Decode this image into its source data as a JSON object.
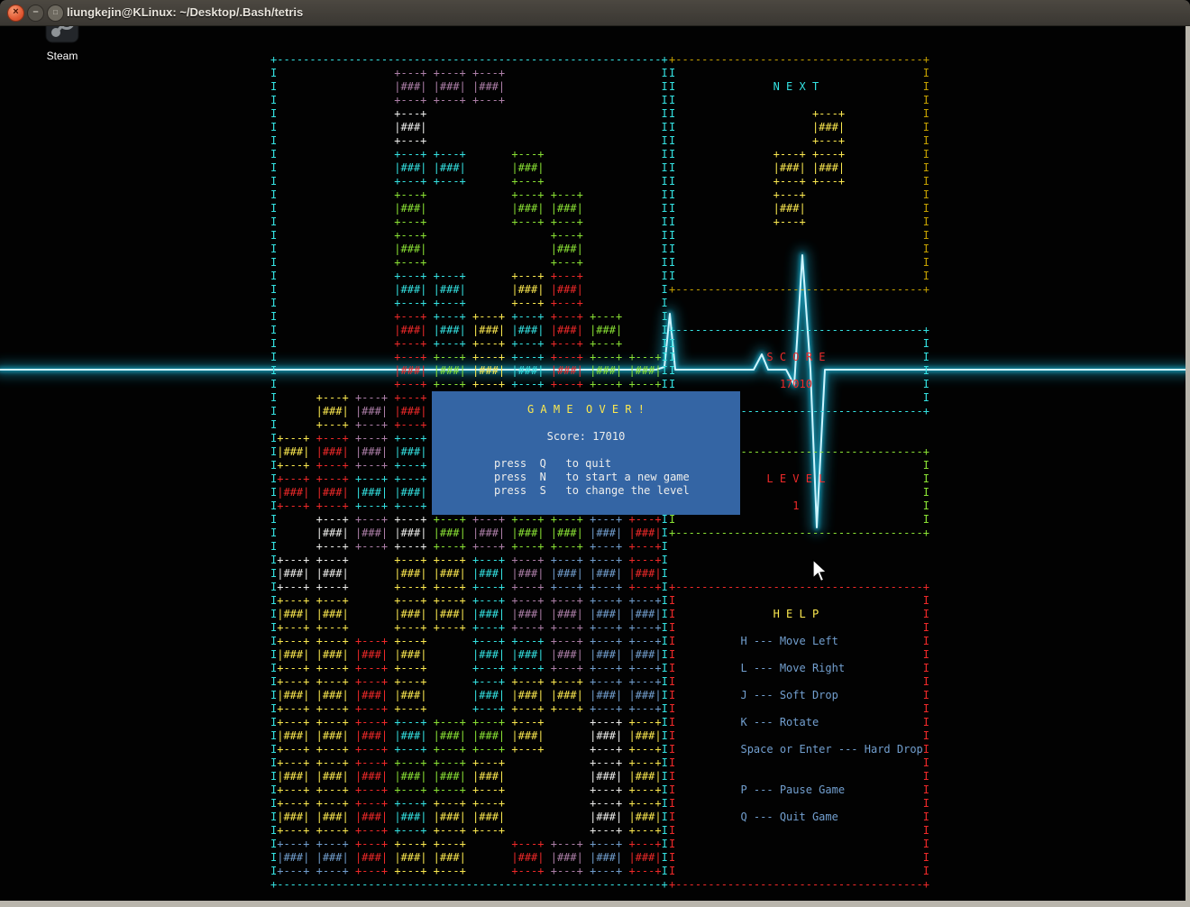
{
  "window": {
    "title": "liungkejin@KLinux: ~/Desktop/.Bash/tetris"
  },
  "desktop": {
    "steam_label": "Steam"
  },
  "palette": {
    "cyan": "#34e2e2",
    "green": "#8ae234",
    "yellow": "#fce94f",
    "red": "#ef2929",
    "magenta": "#ad7fa8",
    "blue": "#729fcf",
    "white": "#eeeeec",
    "field_border": "#34e2e2",
    "next_border": "#c4a000",
    "score_border": "#34e2e2",
    "level_border": "#8ae234",
    "help_border": "#ef2929",
    "help_text": "#729fcf",
    "dialog_bg": "#3465a4",
    "ekg": "#1ec8ee"
  },
  "playfield": {
    "cols": 10,
    "rows": 20,
    "grid": [
      "...MMM....",
      "...W......",
      "...CC.G...",
      "...G..GG..",
      "...G...G..",
      "...CC.YR..",
      "...RCYCRG.",
      "...RGYCRGG",
      ".YMR......",
      "YRMC......",
      "RRCC......",
      ".WMWGMGGBR",
      "WW.YYCMBBR",
      "YY.YYCMMBB",
      "YYRY.CCMBB",
      "YYRY.CYYBB",
      "YYRCGGY.WY",
      "YYRGGY..WY",
      "YYRCYY..WY",
      "BBRYY.RMBR"
    ]
  },
  "next_box": {
    "title": "N E X T",
    "piece": [
      ".Y",
      "YY",
      "Y."
    ]
  },
  "score_box": {
    "title": "S C O R E",
    "value": "17010"
  },
  "level_box": {
    "title": "L E V E L",
    "value": "1"
  },
  "help_box": {
    "title": "H E L P",
    "items": [
      "H --- Move Left",
      "L --- Move Right",
      "J --- Soft Drop",
      "K --- Rotate",
      "Space or Enter --- Hard Drop",
      "P --- Pause Game",
      "Q --- Quit Game"
    ]
  },
  "dialog": {
    "title": "G A M E  O V E R !",
    "score_label": "Score: 17010",
    "lines": [
      "press  Q   to quit",
      "press  N   to start a new game",
      "press  S   to change the level"
    ]
  }
}
